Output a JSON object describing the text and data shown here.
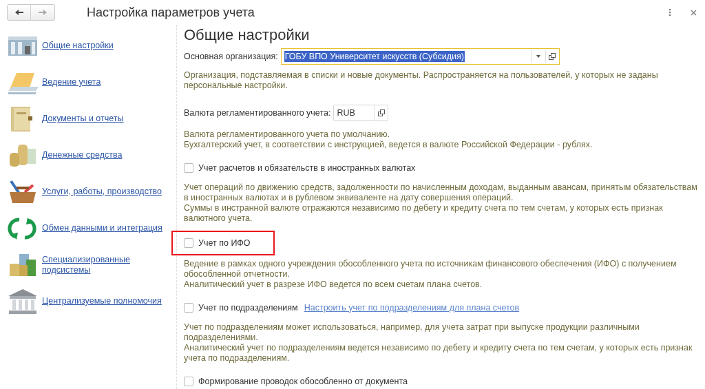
{
  "window": {
    "title": "Настройка параметров учета"
  },
  "sidebar": {
    "items": [
      {
        "label": "Общие настройки"
      },
      {
        "label": "Ведение учета"
      },
      {
        "label": "Документы и отчеты"
      },
      {
        "label": "Денежные средства"
      },
      {
        "label": "Услуги, работы, производство"
      },
      {
        "label": "Обмен данными и интеграция"
      },
      {
        "label": "Специализированные подсистемы"
      },
      {
        "label": "Централизуемые полномочия"
      }
    ]
  },
  "heading": "Общие настройки",
  "organization": {
    "label": "Основная организация:",
    "value": "ГОБУ ВПО Университет искусств (Субсидия)",
    "description": [
      "Организация, подставляемая в списки и новые документы. Распространяется на пользователей, у которых не заданы персональные настройки."
    ]
  },
  "currency": {
    "label": "Валюта регламентированного учета:",
    "value": "RUB",
    "description": [
      "Валюта регламентированного учета по умолчанию.",
      "Бухгалтерский учет, в соответствии с инструкцией, ведется в валюте Российской Федерации - рублях."
    ]
  },
  "options": [
    {
      "label": "Учет расчетов и обязательств в иностранных валютах",
      "checked": false,
      "highlighted": false,
      "description": [
        "Учет операций по движению средств, задолженности по начисленным доходам, выданным авансам, принятым обязательствам в иностранных валютах и в рублевом эквиваленте на дату совершения операций.",
        "Суммы в инстранной валюте отражаются независимо по дебету и кредиту счета по тем счетам, у которых есть признак валютного учета."
      ]
    },
    {
      "label": "Учет по ИФО",
      "checked": false,
      "highlighted": true,
      "description": [
        "Ведение в рамках одного учреждения обособленного учета по источникам финансового обеспечения (ИФО) с получением обособленной отчетности.",
        "Аналитический учет в разрезе ИФО ведется по всем счетам плана счетов."
      ]
    },
    {
      "label": "Учет по подразделениям",
      "checked": false,
      "highlighted": false,
      "link": "Настроить учет по подразделениям для плана счетов",
      "description": [
        "Учет по подразделениям может использоваться, например, для учета затрат при выпуске продукции различными подразделениями.",
        "Аналитический учет по подразделениям ведется независимо по дебету и кредиту счета по тем счетам, у которых есть признак учета по подразделениям."
      ]
    },
    {
      "label": "Формирование проводок обособленно от документа",
      "checked": false,
      "highlighted": false
    }
  ]
}
